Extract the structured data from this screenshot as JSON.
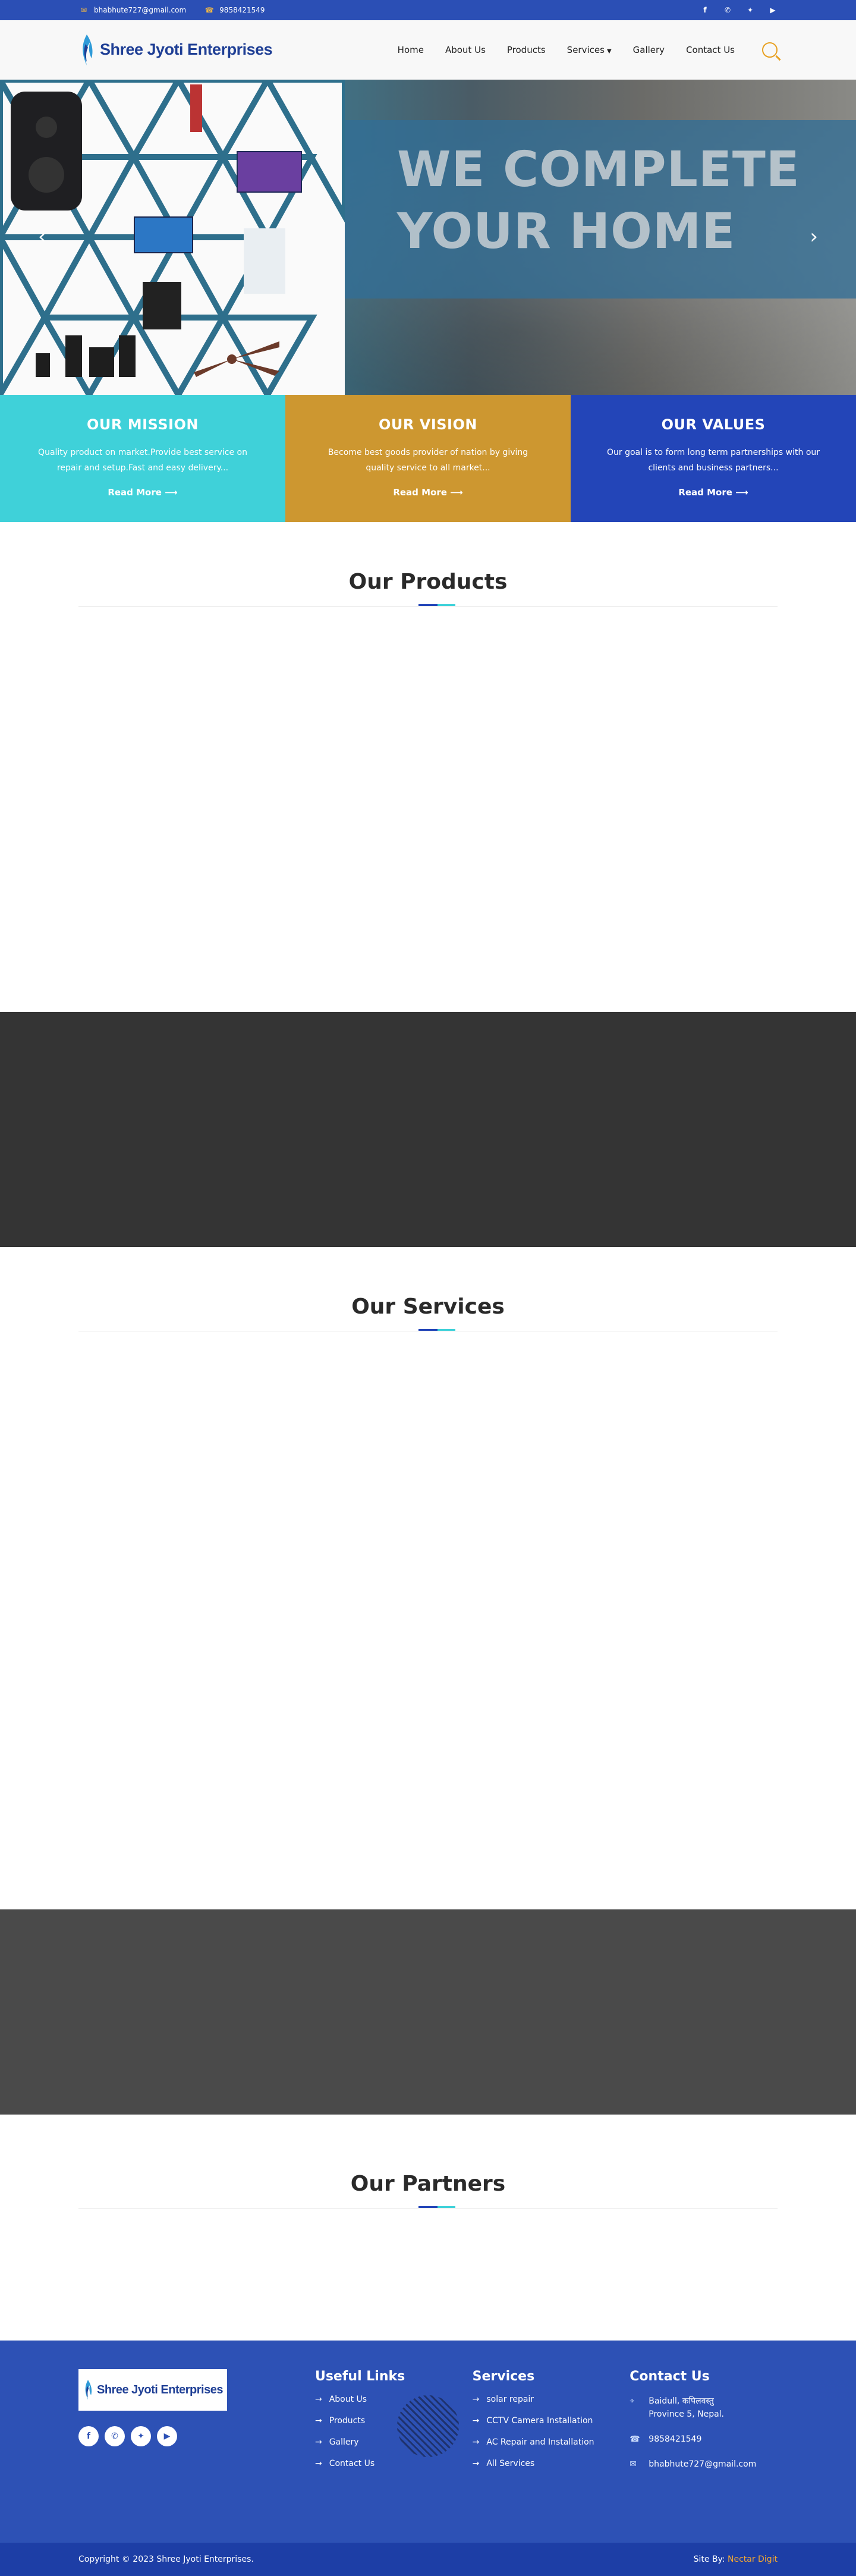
{
  "topbar": {
    "email": "bhabhute727@gmail.com",
    "phone": "9858421549",
    "socials": [
      "facebook-icon",
      "whatsapp-icon",
      "twitter-icon",
      "youtube-icon"
    ]
  },
  "header": {
    "logo_text": "Shree Jyoti Enterprises",
    "nav": [
      "Home",
      "About Us",
      "Products",
      "Services",
      "Gallery",
      "Contact Us"
    ]
  },
  "hero": {
    "headline_line1": "WE COMPLETE",
    "headline_line2": "YOUR HOME"
  },
  "mvv": [
    {
      "title": "OUR MISSION",
      "text": "Quality product on market.Provide best service on repair and setup.Fast and easy delivery...",
      "link": "Read More"
    },
    {
      "title": "OUR VISION",
      "text": "Become best goods provider of nation by giving quality service to all market...",
      "link": "Read More"
    },
    {
      "title": "OUR VALUES",
      "text": "Our goal is to form long term partnerships with our clients and business partners...",
      "link": "Read More"
    }
  ],
  "sections": {
    "products": "Our Products",
    "services": "Our Services",
    "partners": "Our Partners"
  },
  "footer": {
    "logo_text": "Shree Jyoti Enterprises",
    "useful_links_title": "Useful Links",
    "useful_links": [
      "About Us",
      "Products",
      "Gallery",
      "Contact Us"
    ],
    "services_title": "Services",
    "services": [
      "solar repair",
      "CCTV Camera Installation",
      "AC Repair and Installation",
      "All Services"
    ],
    "contact_title": "Contact Us",
    "address_line1": "Baidull, कपिलवस्तु",
    "address_line2": "Province 5, Nepal.",
    "phone": "9858421549",
    "email": "bhabhute727@gmail.com"
  },
  "copyright": {
    "text": "Copyright © 2023 Shree Jyoti Enterprises.",
    "site_by_label": "Site By:",
    "site_by_brand": "Nectar Digit"
  },
  "colors": {
    "primary_blue": "#2b4fb5",
    "accent_cyan": "#3fd1d9",
    "accent_gold": "#cd9730",
    "deep_blue": "#2345b8",
    "orange_link": "#f4a831"
  }
}
